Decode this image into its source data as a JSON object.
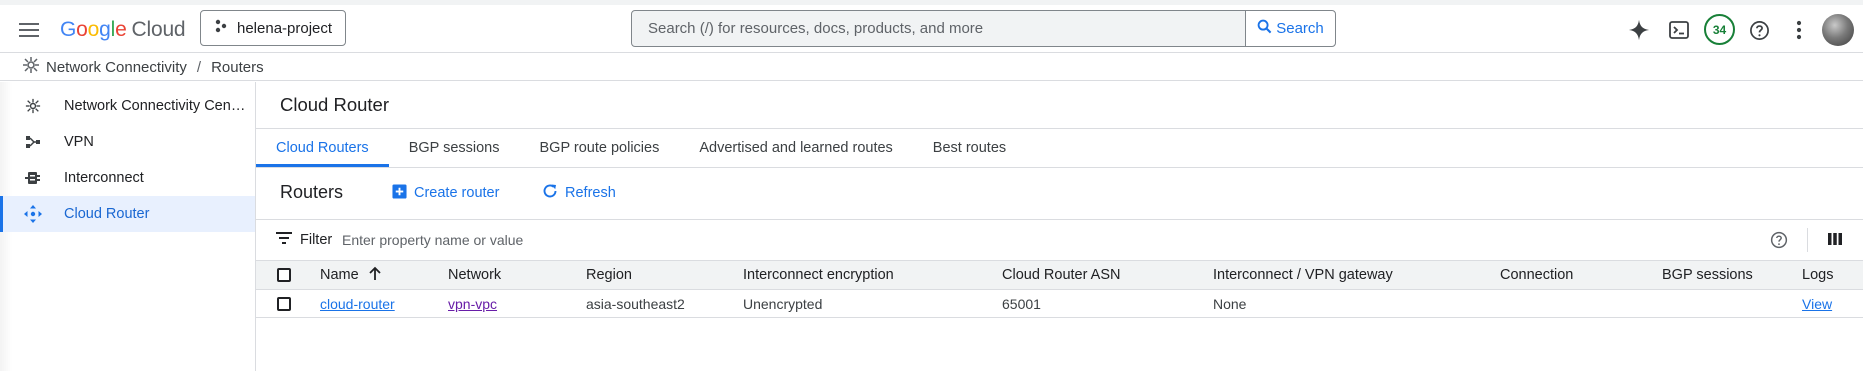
{
  "topbar": {
    "logo": {
      "google": "Google",
      "cloud": "Cloud"
    },
    "project": "helena-project",
    "search_placeholder": "Search (/) for resources, docs, products, and more",
    "search_button": "Search",
    "notifications_count": "34",
    "icons": [
      "menu-icon",
      "project-icon",
      "search-icon",
      "gemini-sparkle-icon",
      "cloud-shell-icon",
      "help-icon",
      "more-vert-icon"
    ]
  },
  "breadcrumb": {
    "service": "Network Connectivity",
    "separator": "/",
    "page": "Routers"
  },
  "sidebar": {
    "items": [
      {
        "label": "Network Connectivity Cen…",
        "icon": "hub-icon",
        "active": false
      },
      {
        "label": "VPN",
        "icon": "vpn-icon",
        "active": false
      },
      {
        "label": "Interconnect",
        "icon": "interconnect-icon",
        "active": false
      },
      {
        "label": "Cloud Router",
        "icon": "cloud-router-icon",
        "active": true
      }
    ]
  },
  "main": {
    "title": "Cloud Router",
    "tabs": [
      {
        "label": "Cloud Routers",
        "active": true
      },
      {
        "label": "BGP sessions",
        "active": false
      },
      {
        "label": "BGP route policies",
        "active": false
      },
      {
        "label": "Advertised and learned routes",
        "active": false
      },
      {
        "label": "Best routes",
        "active": false
      }
    ],
    "section_title": "Routers",
    "create_button": "Create router",
    "refresh_button": "Refresh",
    "filter": {
      "label": "Filter",
      "placeholder": "Enter property name or value"
    },
    "table": {
      "sort_column": "Name",
      "sort_direction": "ascending",
      "columns": [
        "Name",
        "Network",
        "Region",
        "Interconnect encryption",
        "Cloud Router ASN",
        "Interconnect / VPN gateway",
        "Connection",
        "BGP sessions",
        "Logs"
      ],
      "rows": [
        {
          "name": "cloud-router",
          "network": "vpn-vpc",
          "region": "asia-southeast2",
          "encryption": "Unencrypted",
          "asn": "65001",
          "gateway": "None",
          "connection": "",
          "bgp_sessions": "",
          "logs": "View"
        }
      ]
    }
  },
  "colors": {
    "accent": "#1a73e8",
    "active_bg": "#e8f0fe",
    "visited_link": "#681da8",
    "badge_green": "#188038"
  }
}
